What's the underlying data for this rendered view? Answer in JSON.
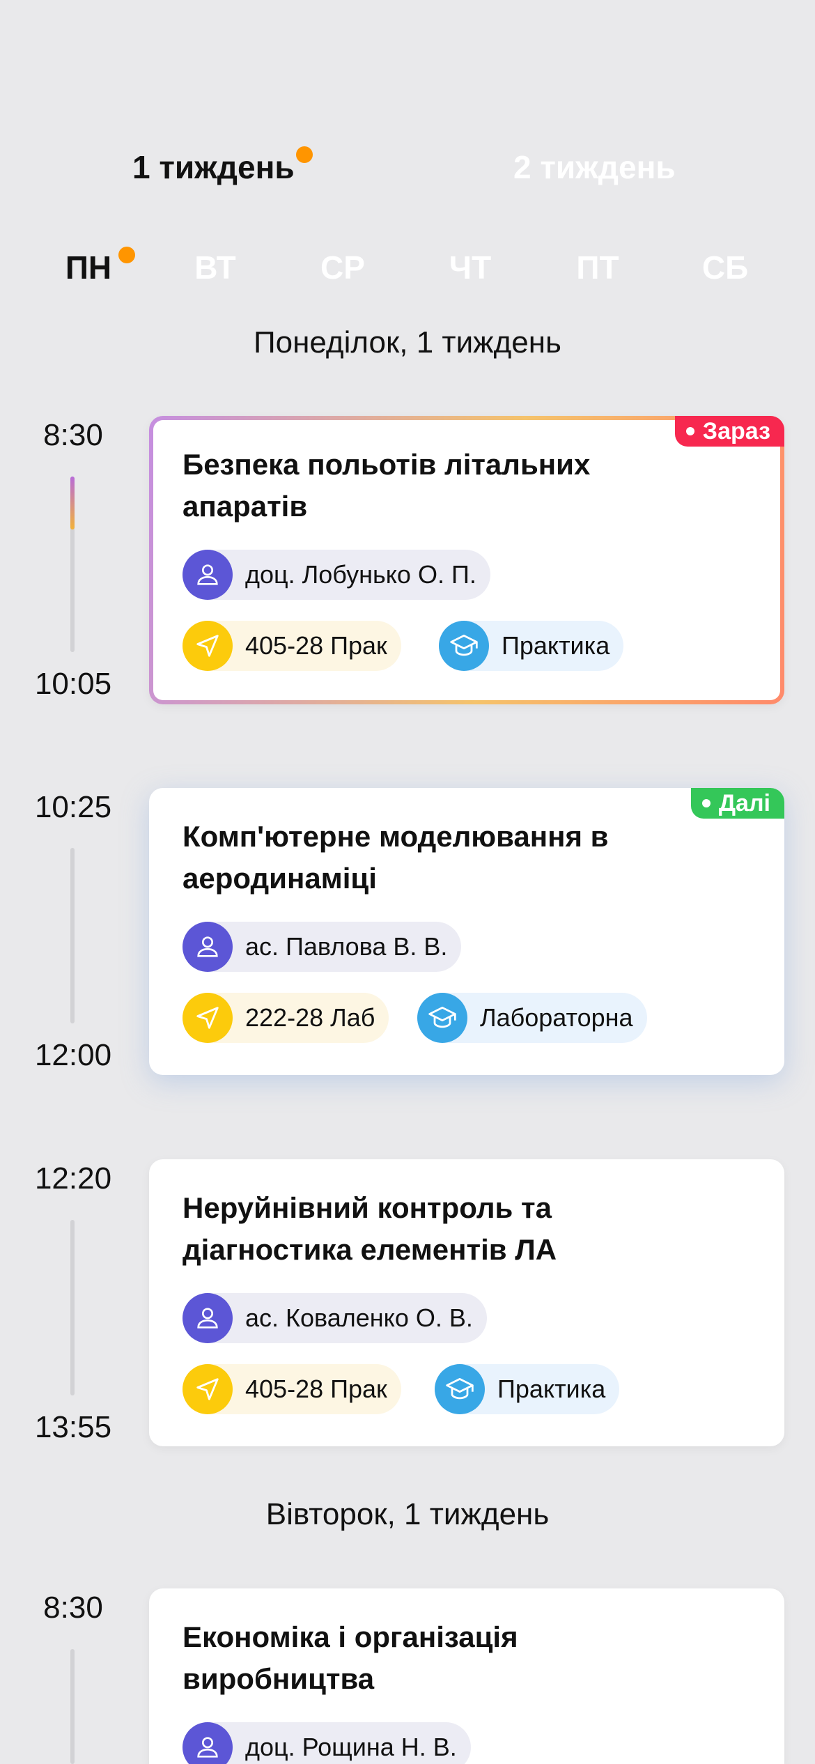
{
  "weeks": {
    "week1": "1 тиждень",
    "week2": "2 тиждень"
  },
  "days": [
    "ПН",
    "ВТ",
    "СР",
    "ЧТ",
    "ПТ",
    "СБ"
  ],
  "sections": {
    "monday": "Понеділок, 1 тиждень",
    "tuesday": "Вівторок, 1 тиждень"
  },
  "badges": {
    "now": "Зараз",
    "next": "Далі"
  },
  "classes": [
    {
      "start": "8:30",
      "end": "10:05",
      "title": "Безпека польотів літальних апаратів",
      "teacher": "доц. Лобунько О. П.",
      "room": "405-28 Прак",
      "type": "Практика"
    },
    {
      "start": "10:25",
      "end": "12:00",
      "title": "Комп'ютерне моделювання в аеродинаміці",
      "teacher": "ас. Павлова В. В.",
      "room": "222-28 Лаб",
      "type": "Лабораторна"
    },
    {
      "start": "12:20",
      "end": "13:55",
      "title": "Неруйнівний контроль та діагностика елементів ЛА",
      "teacher": "ас. Коваленко О. В.",
      "room": "405-28 Прак",
      "type": "Практика"
    },
    {
      "start": "8:30",
      "title": "Економіка і організація виробництва",
      "teacher": "доц. Рощина Н. В."
    }
  ],
  "current_progress": 0.3,
  "colors": {
    "accent_dot": "#ff9500",
    "now_badge": "#f7284f",
    "next_badge": "#34c759",
    "person_icon": "#5c56d6",
    "location_icon": "#fccb0c",
    "type_icon": "#38a7e6"
  },
  "icons": {
    "person": "person-icon",
    "location": "location-arrow-icon",
    "type": "graduation-cap-icon"
  }
}
